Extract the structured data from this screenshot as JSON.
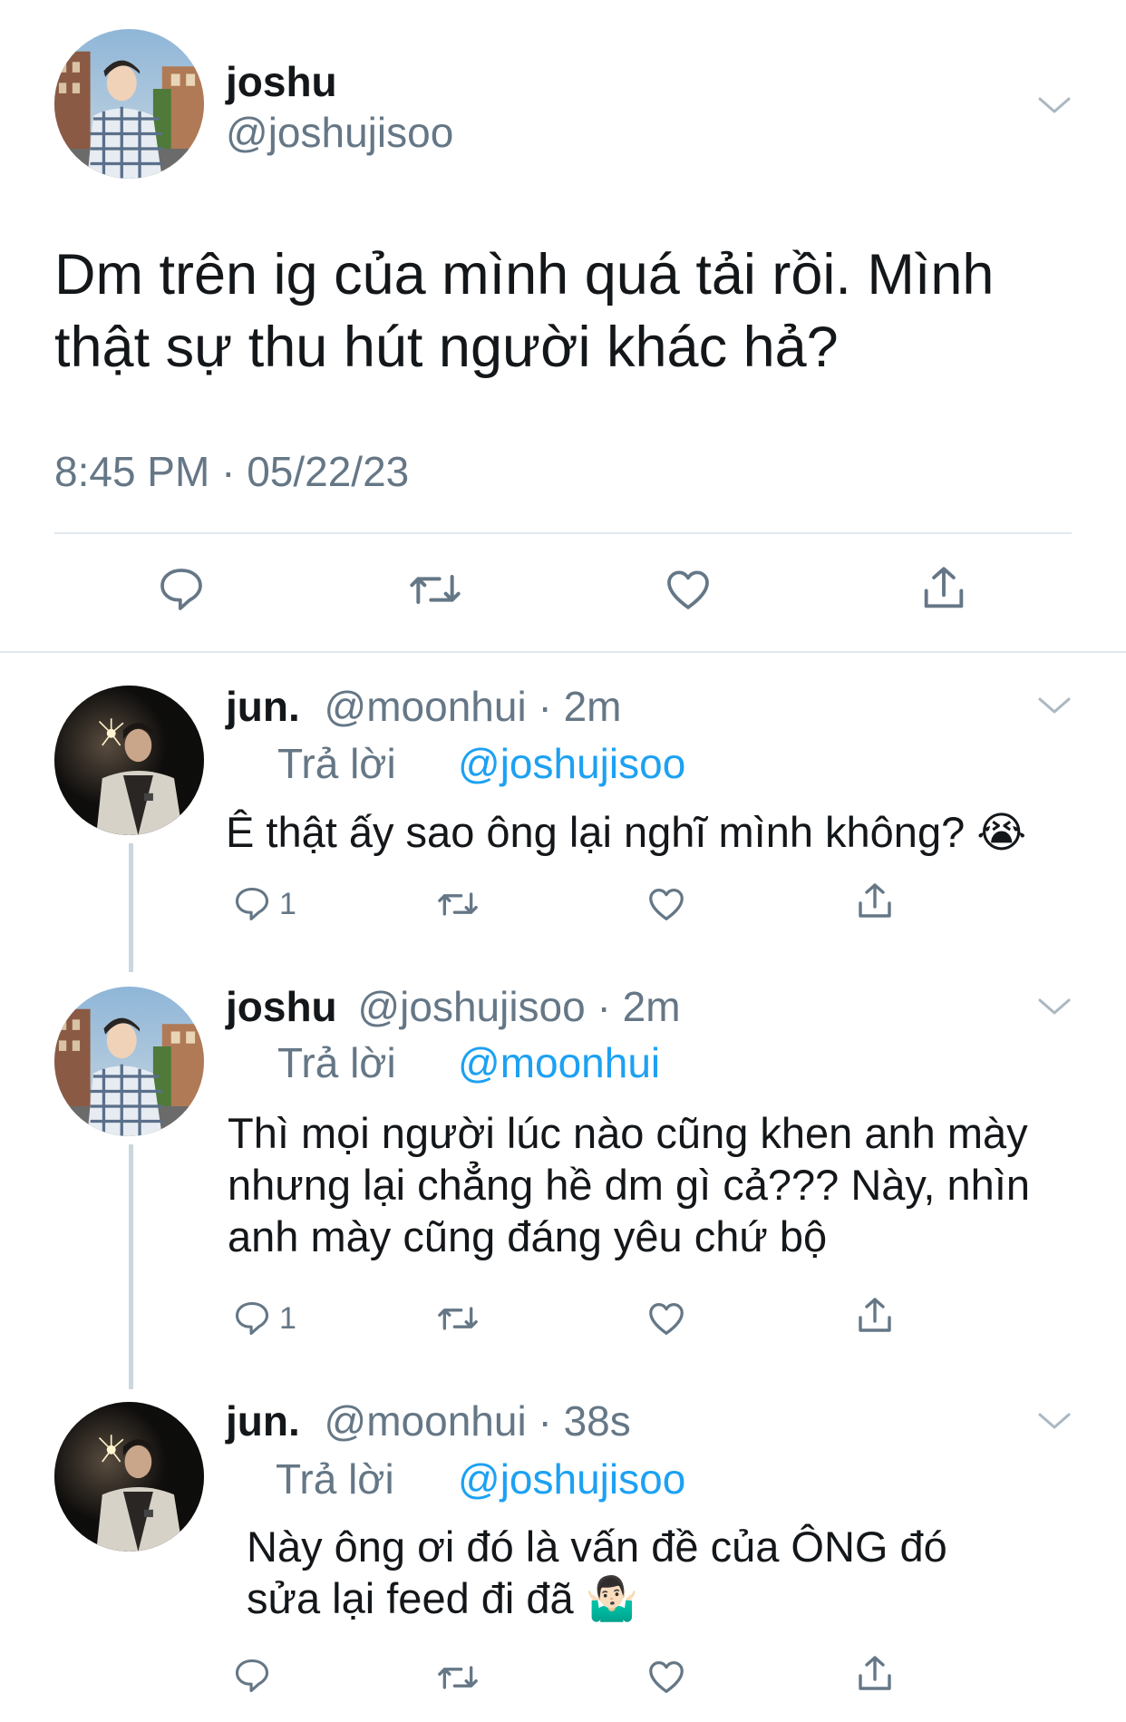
{
  "main_tweet": {
    "name": "joshu",
    "handle": "@joshujisoo",
    "text": "Dm trên ig của mình quá tải rồi. Mình thật sự thu hút người khác hả?",
    "timestamp": "8:45 PM · 05/22/23",
    "icons": [
      "reply-icon",
      "retweet-icon",
      "like-icon",
      "share-icon"
    ]
  },
  "replies": [
    {
      "name": "jun.",
      "handle": "@moonhui",
      "time": "2m",
      "reply_label": "Trả lời",
      "reply_to": "@joshujisoo",
      "text": "Ê thật ấy sao ông lại nghĩ mình không? 😭",
      "reply_count": "1"
    },
    {
      "name": "joshu",
      "handle": "@joshujisoo",
      "time": "2m",
      "reply_label": "Trả lời",
      "reply_to": "@moonhui",
      "text": "Thì mọi người lúc nào cũng khen anh mày nhưng lại chẳng hề dm gì cả??? Này, nhìn anh mày cũng đáng yêu chứ bộ",
      "reply_count": "1"
    },
    {
      "name": "jun.",
      "handle": "@moonhui",
      "time": "38s",
      "reply_label": "Trả lời",
      "reply_to": "@joshujisoo",
      "text": "Này ông ơi đó là vấn đề của ÔNG đó sửa lại feed đi đã 🤷🏻‍♂️",
      "reply_count": ""
    }
  ],
  "colors": {
    "text": "#14171a",
    "secondary": "#657786",
    "link": "#1da1f2",
    "divider": "#e1e8ed"
  }
}
